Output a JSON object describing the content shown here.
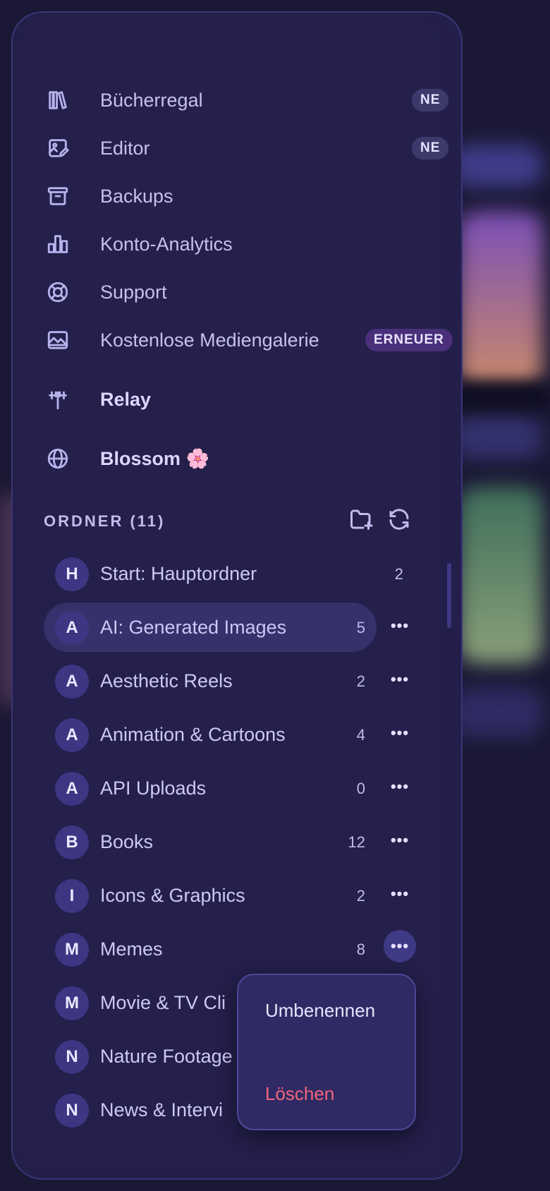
{
  "nav": [
    {
      "label": "Bücherregal",
      "icon": "bookshelf-icon",
      "badge": "NE"
    },
    {
      "label": "Editor",
      "icon": "image-edit-icon",
      "badge": "NE"
    },
    {
      "label": "Backups",
      "icon": "archive-icon"
    },
    {
      "label": "Konto-Analytics",
      "icon": "bar-chart-icon"
    },
    {
      "label": "Support",
      "icon": "lifebuoy-icon"
    },
    {
      "label": "Kostenlose Mediengalerie",
      "icon": "gallery-icon",
      "badge": "ERNEUER"
    },
    {
      "label": "Relay",
      "icon": "antenna-icon"
    },
    {
      "label": "Blossom 🌸",
      "icon": "globe-icon"
    }
  ],
  "folders_section": {
    "title": "ORDNER (11)",
    "add_icon": "folder-add-icon",
    "refresh_icon": "refresh-icon"
  },
  "folders": [
    {
      "initial": "H",
      "name": "Start: Hauptordner",
      "count": "2"
    },
    {
      "initial": "A",
      "name": "AI: Generated Images",
      "count": "5"
    },
    {
      "initial": "A",
      "name": "Aesthetic Reels",
      "count": "2"
    },
    {
      "initial": "A",
      "name": "Animation & Cartoons",
      "count": "4"
    },
    {
      "initial": "A",
      "name": "API Uploads",
      "count": "0"
    },
    {
      "initial": "B",
      "name": "Books",
      "count": "12"
    },
    {
      "initial": "I",
      "name": "Icons & Graphics",
      "count": "2"
    },
    {
      "initial": "M",
      "name": "Memes",
      "count": "8"
    },
    {
      "initial": "M",
      "name": "Movie & TV Cli",
      "count": ""
    },
    {
      "initial": "N",
      "name": "Nature Footage",
      "count": ""
    },
    {
      "initial": "N",
      "name": "News & Intervi",
      "count": ""
    }
  ],
  "more_glyph": "•••",
  "context_menu": {
    "rename": "Umbenennen",
    "delete": "Löschen"
  }
}
